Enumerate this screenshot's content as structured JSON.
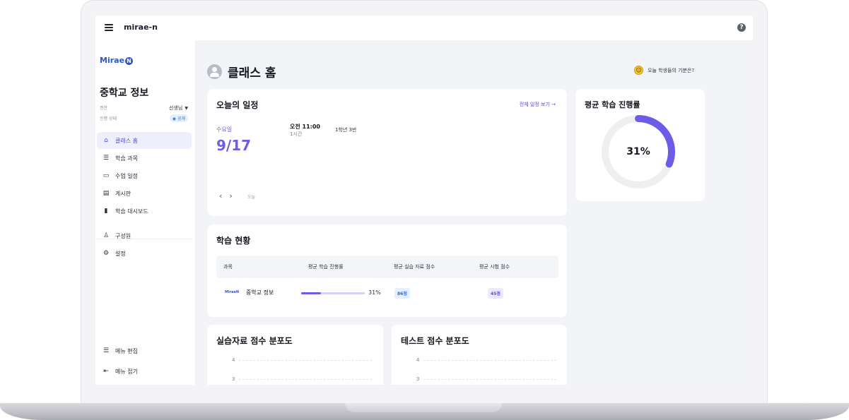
{
  "topbar": {
    "app_name": "mirae-n",
    "help_glyph": "?"
  },
  "sidebar": {
    "logo_text": "Mirae",
    "logo_badge": "N",
    "class_title": "중학교 정보",
    "permission_label": "권한",
    "permission_value": "선생님",
    "status_label": "진행 상태",
    "status_value": "공개",
    "nav_items": [
      {
        "label": "클래스 홈",
        "icon": "home-icon"
      },
      {
        "label": "학습 과목",
        "icon": "list-icon"
      },
      {
        "label": "수업 일정",
        "icon": "calendar-icon"
      },
      {
        "label": "게시판",
        "icon": "board-icon"
      },
      {
        "label": "학습 대시보드",
        "icon": "bar-chart-icon"
      },
      {
        "label": "구성원",
        "icon": "person-icon"
      },
      {
        "label": "설정",
        "icon": "gear-icon"
      }
    ],
    "footer_items": [
      {
        "label": "메뉴 편집",
        "icon": "list-icon"
      },
      {
        "label": "메뉴 접기",
        "icon": "collapse-icon"
      }
    ]
  },
  "main": {
    "page_title": "클래스 홈",
    "mood_text": "오늘 학생들의 기분은?",
    "schedule": {
      "title": "오늘의 일정",
      "see_all": "전체 일정 보기",
      "day": "수요일",
      "date": "9/17",
      "event_time": "오전 11:00",
      "event_duration": "1시간",
      "event_class": "1학년 3반",
      "today_label": "오늘"
    },
    "progress": {
      "title": "평균 학습 진행률",
      "value_text": "31%",
      "fraction": 0.31
    },
    "learning_status": {
      "title": "학습 현황",
      "columns": [
        "과목",
        "평균 학습 진행률",
        "평균 실습 자료 점수",
        "평균 시험 점수"
      ],
      "rows": [
        {
          "logo": "MiraeN",
          "course": "중학교 정보",
          "progress_fraction": 0.31,
          "progress_text": "31%",
          "practice_score": "86점",
          "test_score": "45점"
        }
      ]
    },
    "practice_dist": {
      "title": "실습자료 점수 분포도",
      "ticks": [
        "4",
        "3"
      ]
    },
    "test_dist": {
      "title": "테스트 점수 분포도",
      "ticks": [
        "4",
        "3"
      ]
    }
  },
  "colors": {
    "accent": "#6c5ce7",
    "brand": "#2c56c9",
    "ring_track": "#efeff2"
  }
}
